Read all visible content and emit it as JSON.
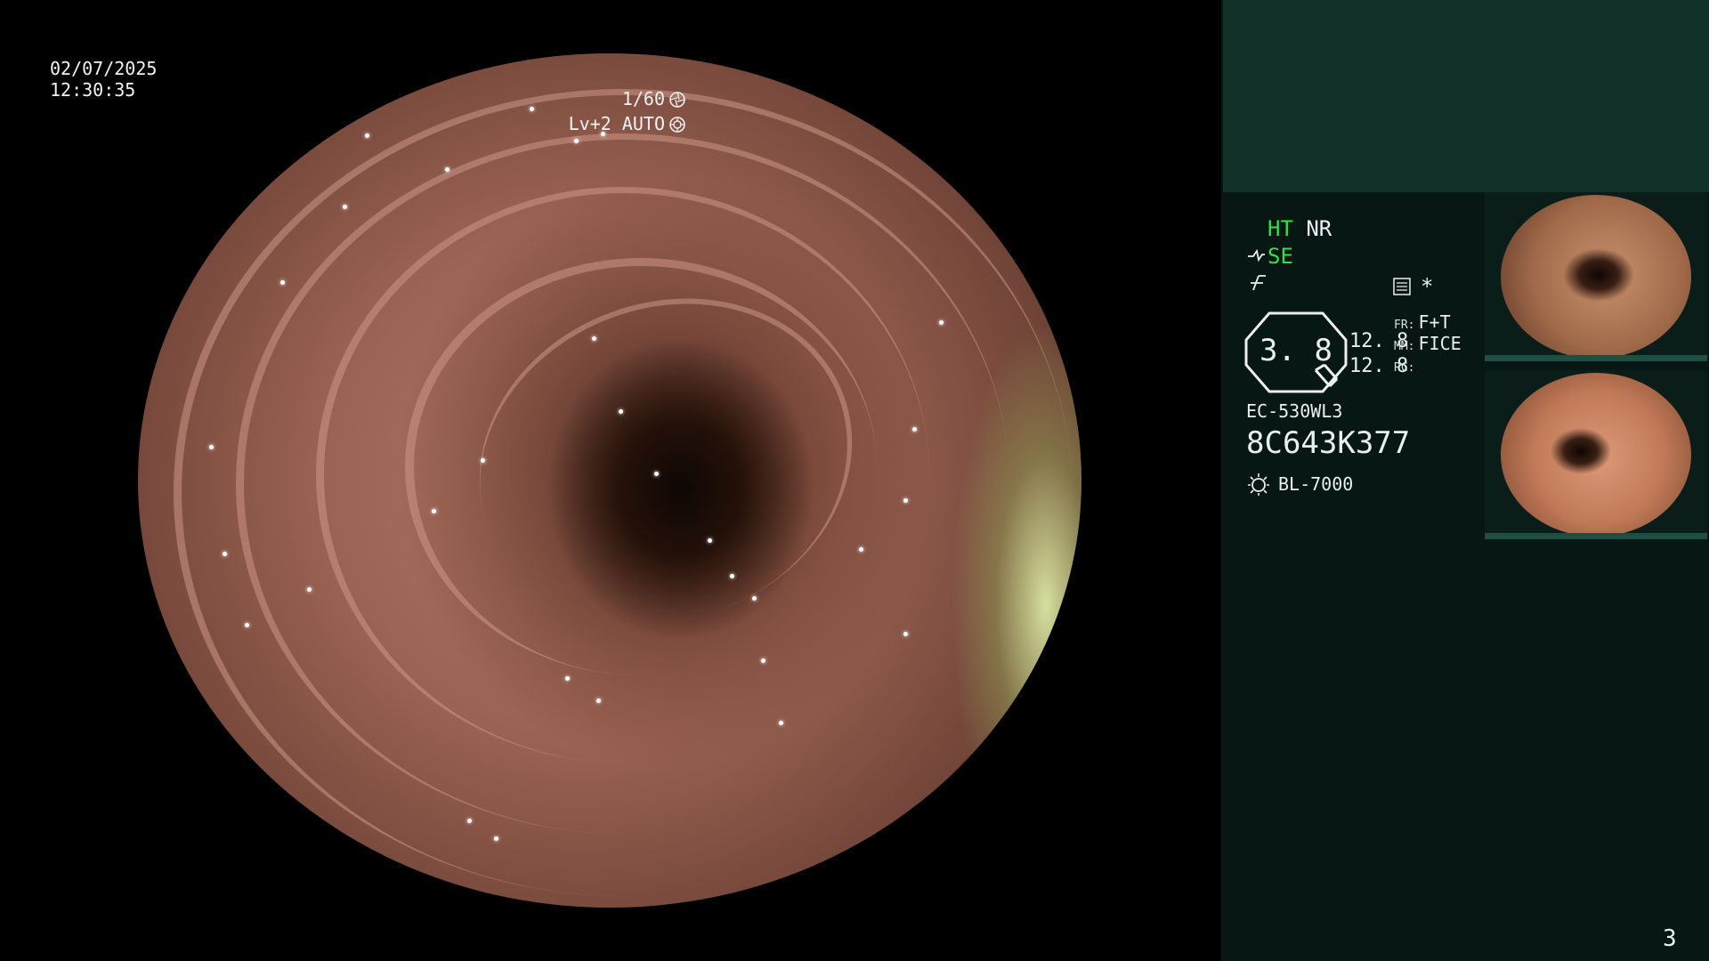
{
  "overlay": {
    "date": "02/07/2025",
    "time": "12:30:35",
    "shutter": "1/60",
    "exposure": "Lv+2 AUTO",
    "channel": "3"
  },
  "panel": {
    "ht": "HT",
    "nr": "NR",
    "se": "SE",
    "asterisk": "*",
    "zoom_value": "3. 8",
    "val1": "12. 8",
    "val2": "12. 8",
    "fr_label": "FR:",
    "fr_value": "F+T",
    "mm_label": "MM:",
    "mm_value": "FICE",
    "rc_label": "RC:",
    "scope_model": "EC-530WL3",
    "scope_serial": "8C643K377",
    "light_source": "BL-7000"
  },
  "colors": {
    "panel_bg": "#071714",
    "panel_top": "#123129",
    "status_green": "#33e046"
  },
  "icons": [
    "aperture-icon",
    "auto-iris-icon",
    "structure-enhance-icon",
    "color-icon",
    "record-icon",
    "zoom-icon",
    "light-source-icon"
  ]
}
